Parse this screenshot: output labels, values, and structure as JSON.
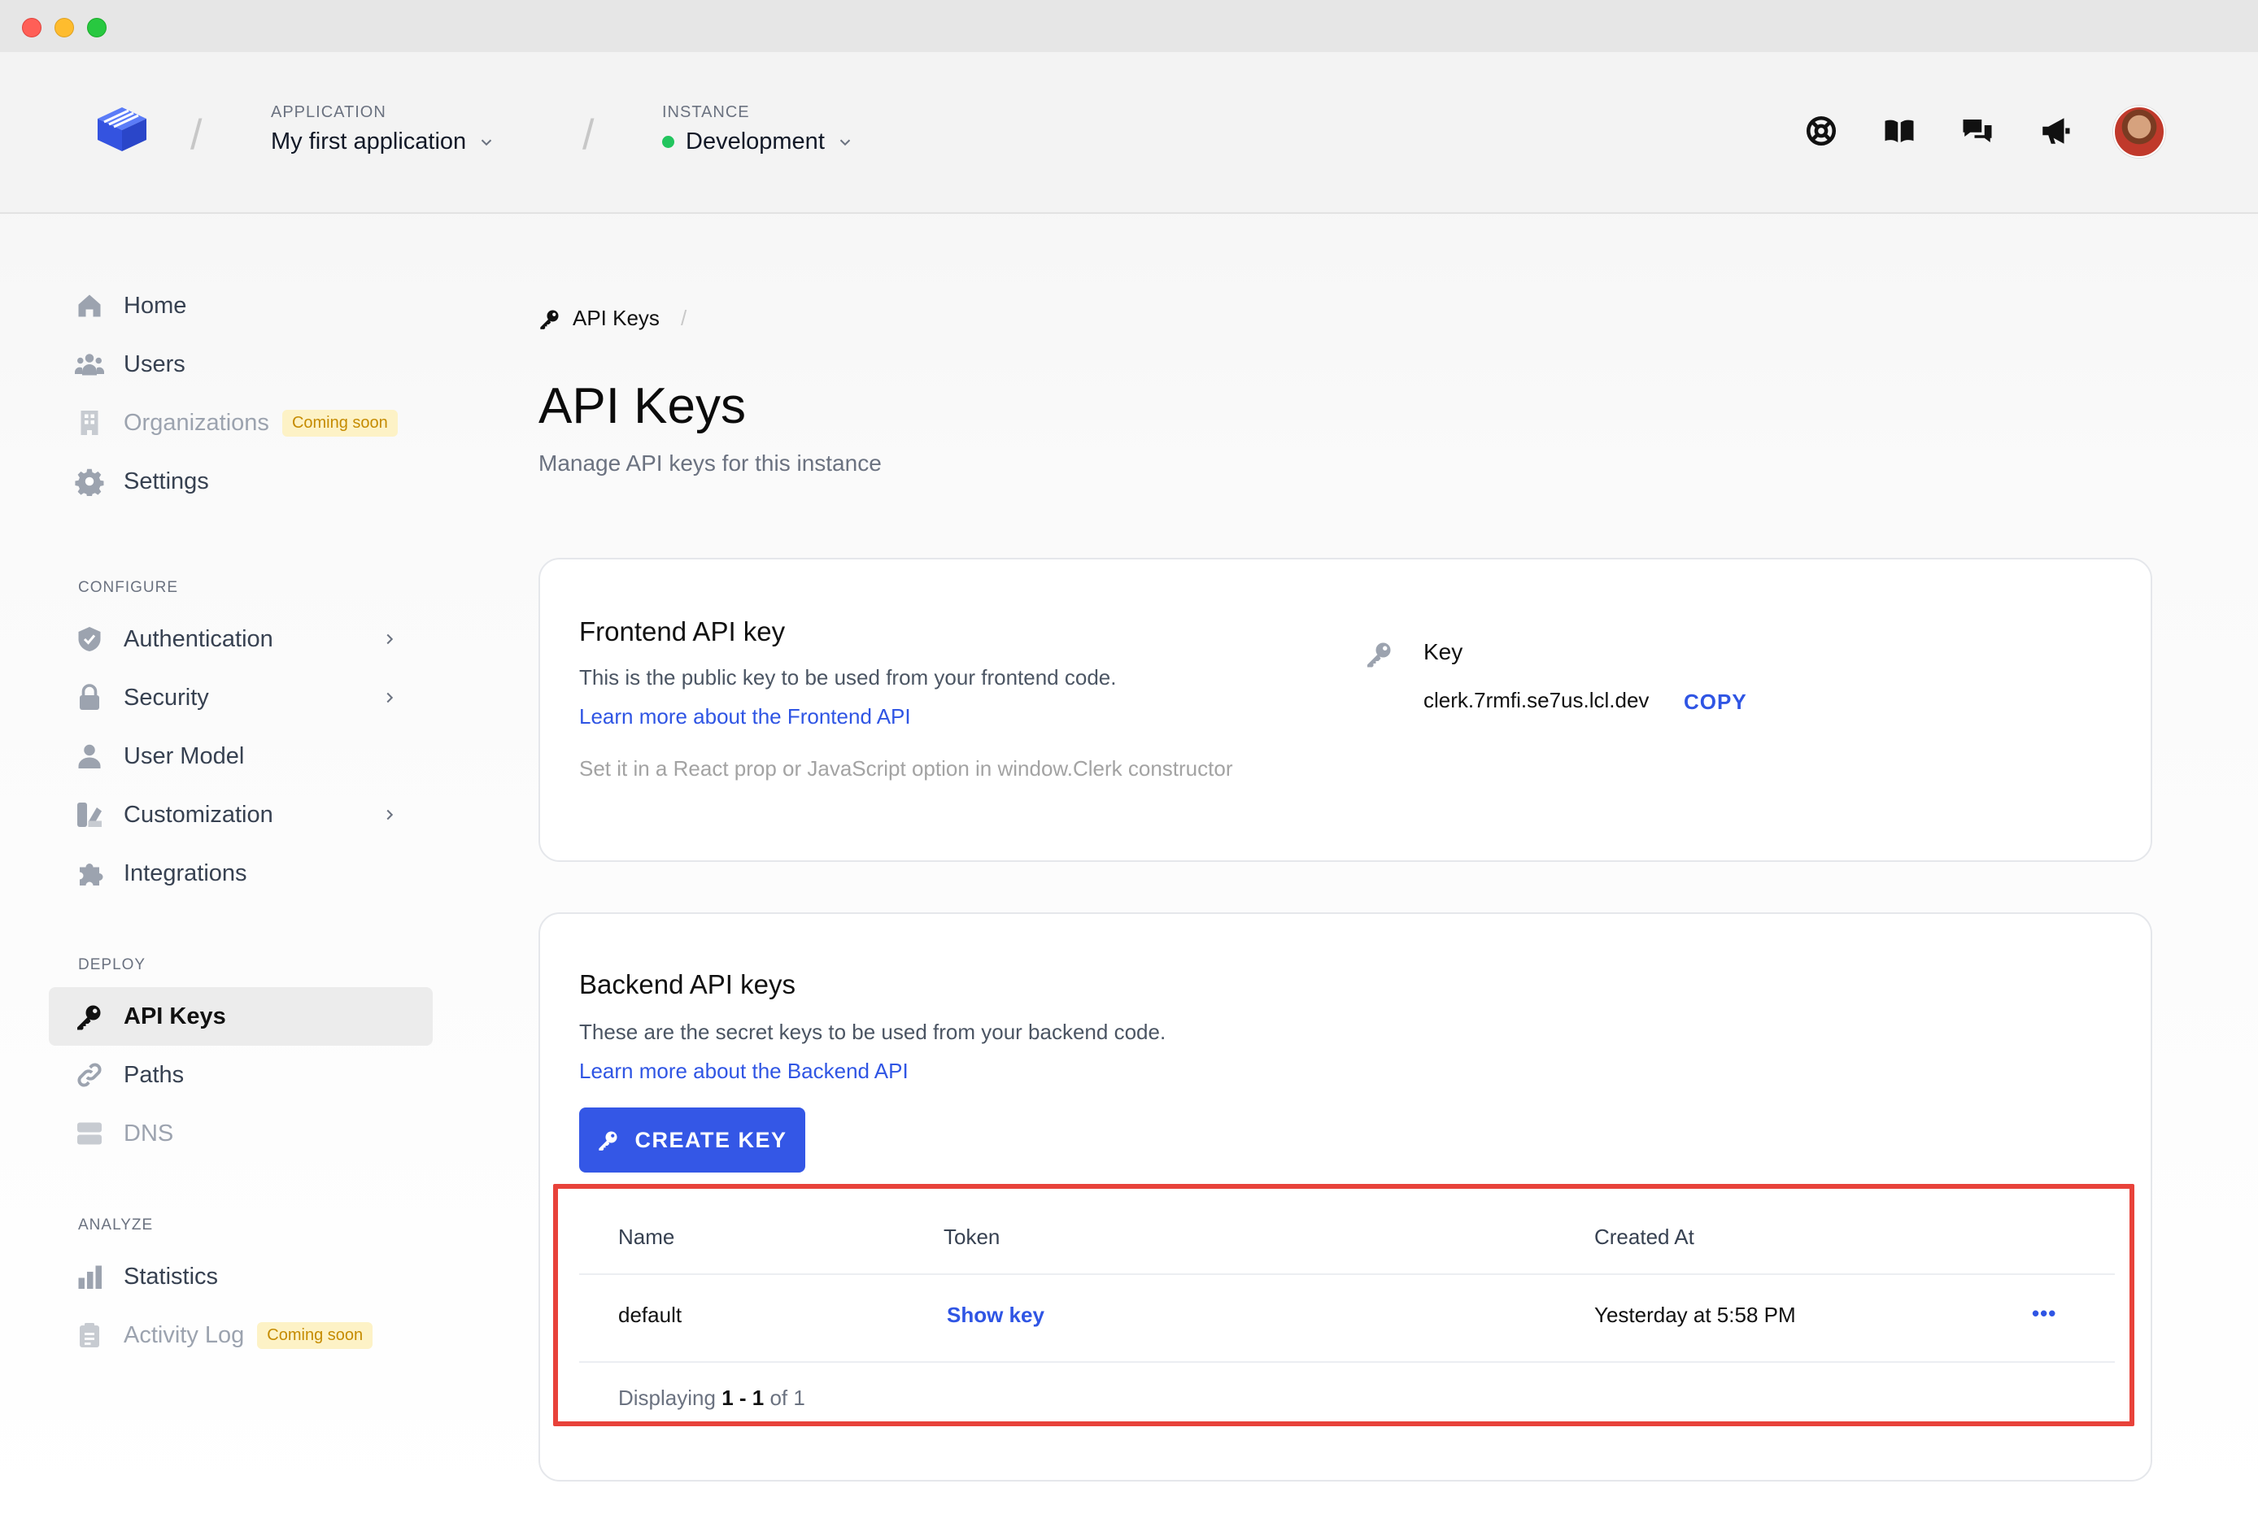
{
  "header": {
    "application_label": "APPLICATION",
    "application_value": "My first application",
    "instance_label": "INSTANCE",
    "instance_value": "Development",
    "instance_status_color": "#22c55e",
    "icons": [
      "support-icon",
      "docs-book-icon",
      "chat-icon",
      "announcements-megaphone-icon"
    ],
    "avatar": "user-avatar"
  },
  "sidebar": {
    "top_items": [
      {
        "label": "Home",
        "icon": "home-icon"
      },
      {
        "label": "Users",
        "icon": "users-icon"
      },
      {
        "label": "Organizations",
        "icon": "building-icon",
        "badge": "Coming soon"
      },
      {
        "label": "Settings",
        "icon": "gear-icon"
      }
    ],
    "configure_title": "CONFIGURE",
    "configure_items": [
      {
        "label": "Authentication",
        "icon": "shield-icon"
      },
      {
        "label": "Security",
        "icon": "lock-icon"
      },
      {
        "label": "User Model",
        "icon": "user-icon"
      },
      {
        "label": "Customization",
        "icon": "palette-icon"
      },
      {
        "label": "Integrations",
        "icon": "puzzle-icon"
      }
    ],
    "deploy_title": "DEPLOY",
    "deploy_items": [
      {
        "label": "API Keys",
        "icon": "key-icon",
        "active": true
      },
      {
        "label": "Paths",
        "icon": "link-icon"
      },
      {
        "label": "DNS",
        "icon": "server-icon"
      }
    ],
    "analyze_title": "ANALYZE",
    "analyze_items": [
      {
        "label": "Statistics",
        "icon": "bar-chart-icon"
      },
      {
        "label": "Activity Log",
        "icon": "clipboard-icon",
        "badge": "Coming soon"
      }
    ]
  },
  "main": {
    "breadcrumb": "API Keys",
    "title": "API Keys",
    "subtitle": "Manage API keys for this instance",
    "frontend": {
      "title": "Frontend API key",
      "description": "This is the public key to be used from your frontend code.",
      "link": "Learn more about the Frontend API",
      "hint": "Set it in a React prop or JavaScript option in window.Clerk constructor",
      "key_label": "Key",
      "key_value": "clerk.7rmfi.se7us.lcl.dev",
      "copy_label": "COPY"
    },
    "backend": {
      "title": "Backend API keys",
      "description": "These are the secret keys to be used from your backend code.",
      "link": "Learn more about the Backend API",
      "create_label": "CREATE KEY",
      "table": {
        "columns": [
          "Name",
          "Token",
          "Created At"
        ],
        "rows": [
          {
            "name": "default",
            "token": "Show key",
            "created_at": "Yesterday at 5:58 PM",
            "actions": "•••"
          }
        ],
        "footer_prefix": "Displaying",
        "footer_range": "1 - 1",
        "footer_of": "of 1"
      }
    }
  }
}
